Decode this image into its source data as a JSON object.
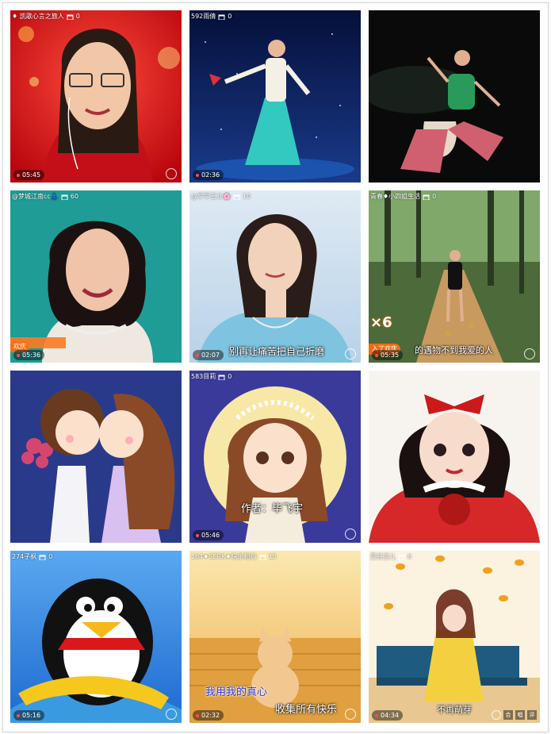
{
  "tiles": [
    {
      "user": "♦ 凯歌心言之旅人",
      "gifts": "0",
      "duration": "05:45",
      "caption": ""
    },
    {
      "user": "592雨倩",
      "gifts": "0",
      "duration": "02:36",
      "caption": ""
    },
    {
      "user": "",
      "gifts": "",
      "duration": "",
      "caption": ""
    },
    {
      "user": "@梦城江南cc👗",
      "gifts": "60",
      "duration": "05:36",
      "caption": "",
      "live_label": "欢庆"
    },
    {
      "user": "@亭亭玉立🌸",
      "gifts": "10",
      "duration": "02:07",
      "caption": "别再让痛苦把自己折磨"
    },
    {
      "user": "青春♦小四姐生活",
      "gifts": "0",
      "duration": "05:35",
      "caption": "的遇物不到我爱的人",
      "live_label": "入了欢庆",
      "multiplier": "×6"
    },
    {
      "user": "",
      "gifts": "",
      "duration": "",
      "caption": ""
    },
    {
      "user": "583目莉",
      "gifts": "0",
      "duration": "05:46",
      "caption": "作者：毕飞宇"
    },
    {
      "user": "",
      "gifts": "",
      "duration": "",
      "caption": ""
    },
    {
      "user": "274子枫",
      "gifts": "0",
      "duration": "05:16",
      "caption": ""
    },
    {
      "user": "164♦SERK♦快乐相约",
      "gifts": "15",
      "duration": "02:32",
      "caption": "我用我的真心",
      "caption2": "收集所有快乐"
    },
    {
      "user": "曼芸宝儿",
      "gifts": "6",
      "duration": "04:34",
      "caption": "不再萌芽",
      "chips": [
        "合",
        "唱",
        "评"
      ]
    }
  ],
  "colors": {
    "accent": "#ff4b55",
    "live": "#ff6e14"
  }
}
